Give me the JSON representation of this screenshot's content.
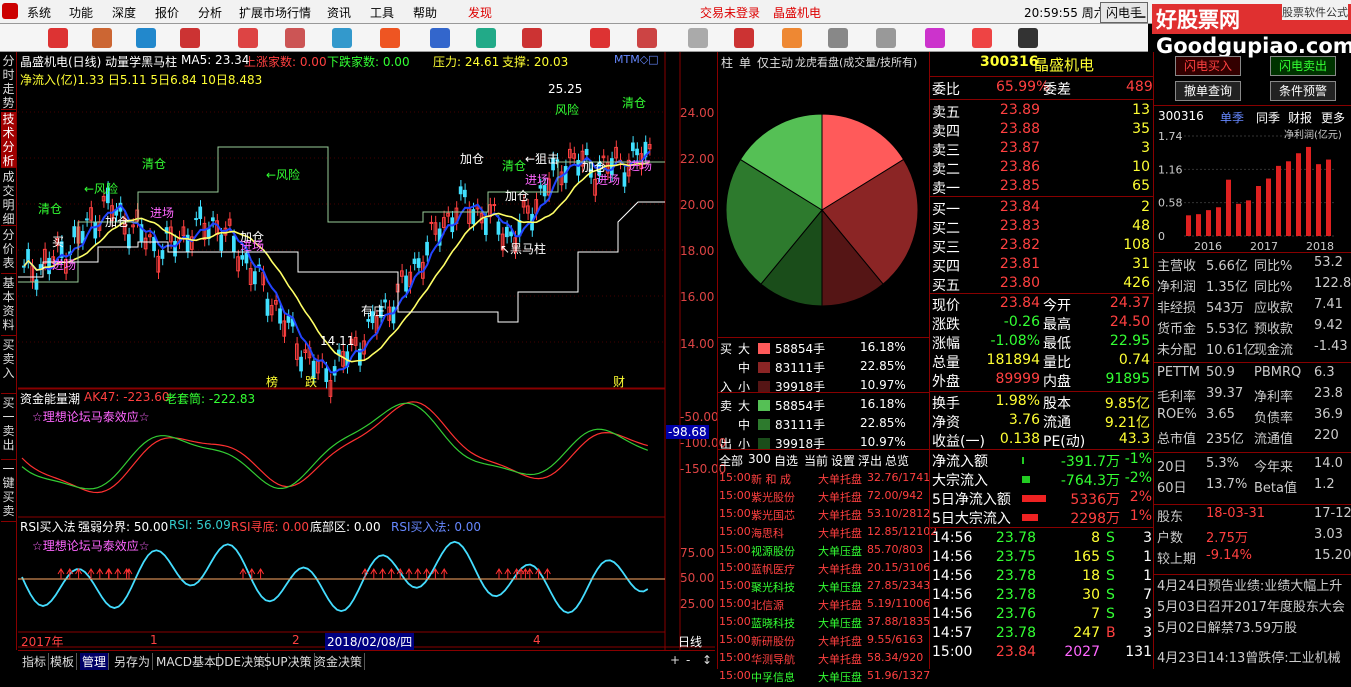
{
  "menu": {
    "items": [
      "系统",
      "功能",
      "深度",
      "报价",
      "分析",
      "扩展市场行情",
      "资讯",
      "工具",
      "帮助"
    ],
    "discover": "发现",
    "login": "交易未登录",
    "stock_name": "晶盛机电",
    "clock": "20:59:55 周六",
    "flash": "闪电手"
  },
  "brand": {
    "logo": "好股票网Goodgupiao.com",
    "sub": "股票软件公式"
  },
  "left_tabs": [
    "分时走势",
    "技术分析",
    "成交明细",
    "分价表",
    "基本资料",
    "买卖入",
    "买一卖出",
    "一键买卖"
  ],
  "chart": {
    "title": "晶盛机电(日线) 动量学黑马柱",
    "ma5": "MA5: 23.34",
    "up_count": "上涨家数: 0.00",
    "down_count": "下跌家数: 0.00",
    "pressure": "压力: 24.61",
    "support": "支撑: 20.03",
    "mtm": "MTM◇□",
    "net_flow": "净流入(亿)1.33 日5.11 5日6.84 10日8.483",
    "labels": {
      "high": "25.25",
      "low": "14.11",
      "risk1": "风险",
      "risk2": "←风险",
      "risk3": "←风险",
      "clear1": "清仓",
      "clear2": "清仓",
      "clear3": "清仓",
      "clear4": "清仓",
      "add1": "加仓",
      "add2": "加仓",
      "add3": "加仓",
      "add4": "加仓",
      "add5": "加仓",
      "enter1": "进场",
      "enter2": "进场",
      "enter3": "进场",
      "enter4": "进场",
      "enter5": "进场",
      "buy": "买",
      "hold": "有庄",
      "blackhorse": "↖黑马柱",
      "block": "←狙击",
      "bang": "榜",
      "die": "跌",
      "cai": "财"
    },
    "y_ticks": [
      "24.00",
      "22.00",
      "20.00",
      "18.00",
      "16.00",
      "14.00"
    ]
  },
  "panel2": {
    "title": "资金能量潮",
    "ak47": "AK47: -223.60",
    "lao": "老套筒: -222.83",
    "tag": "☆理想论坛马泰效应☆",
    "y_ticks": [
      "-50.00",
      "-100.00",
      "-150.00"
    ],
    "cur": "-98.68"
  },
  "panel3": {
    "title": "RSI买入法",
    "strong": "强弱分界: 50.00",
    "rsi": "RSI: 56.09",
    "rsi_low": "RSI寻底: 0.00",
    "bottom": "底部区: 0.00",
    "rsi_buy": "RSI买入法: 0.00",
    "tag": "☆理想论坛马泰效应☆",
    "y_ticks": [
      "75.00",
      "50.00",
      "25.00"
    ]
  },
  "x_axis": {
    "labels": [
      "2017年",
      "1",
      "2",
      "2018/02/08/四",
      "4"
    ],
    "period": "日线"
  },
  "bottom_tabs": [
    "指标",
    "模板",
    "管理",
    "另存为",
    "MACD基本",
    "DDE决策",
    "SUP决策",
    "资金决策"
  ],
  "mid": {
    "tabs": [
      "柱",
      "单",
      "仅主动",
      "龙虎看盘(成交量/技所有)"
    ],
    "pie": {
      "slices": [
        {
          "label": "大买",
          "value": 16.18,
          "color": "#ff5a5a"
        },
        {
          "label": "中买",
          "value": 22.85,
          "color": "#8b2525"
        },
        {
          "label": "小买",
          "value": 10.97,
          "color": "#551515"
        },
        {
          "label": "小卖",
          "value": 10.97,
          "color": "#1a4d1a"
        },
        {
          "label": "中卖",
          "value": 22.85,
          "color": "#2d7a2d"
        },
        {
          "label": "大卖",
          "value": 16.18,
          "color": "#55c055"
        }
      ]
    },
    "buy": [
      {
        "lvl": "大",
        "vol": "58854手",
        "pct": "16.18%",
        "color": "#ff5a5a"
      },
      {
        "lvl": "中",
        "vol": "83111手",
        "pct": "22.85%",
        "color": "#8b2525"
      },
      {
        "lvl": "小",
        "vol": "39918手",
        "pct": "10.97%",
        "color": "#551515"
      }
    ],
    "sell": [
      {
        "lvl": "大",
        "vol": "58854手",
        "pct": "16.18%",
        "color": "#55c055"
      },
      {
        "lvl": "中",
        "vol": "83111手",
        "pct": "22.85%",
        "color": "#2d7a2d"
      },
      {
        "lvl": "小",
        "vol": "39918手",
        "pct": "10.97%",
        "color": "#1a4d1a"
      }
    ],
    "side_buy": [
      "买",
      "入"
    ],
    "side_sell": [
      "卖",
      "出"
    ],
    "filter": [
      "全部",
      "300",
      "自选",
      "当前",
      "设置",
      "浮出",
      "总览"
    ],
    "news": [
      {
        "t": "15:00",
        "n": "新 和 成",
        "k": "大单托盘",
        "v": "32.76/1741"
      },
      {
        "t": "15:00",
        "n": "紫光股份",
        "k": "大单托盘",
        "v": "72.00/942"
      },
      {
        "t": "15:00",
        "n": "紫光国芯",
        "k": "大单托盘",
        "v": "53.10/2812"
      },
      {
        "t": "15:00",
        "n": "海思科",
        "k": "大单托盘",
        "v": "12.85/12102"
      },
      {
        "t": "15:00",
        "n": "视源股份",
        "k": "大单压盘",
        "v": "85.70/803"
      },
      {
        "t": "15:00",
        "n": "蓝帆医疗",
        "k": "大单托盘",
        "v": "20.15/3106"
      },
      {
        "t": "15:00",
        "n": "聚光科技",
        "k": "大单压盘",
        "v": "27.85/2343"
      },
      {
        "t": "15:00",
        "n": "北信源",
        "k": "大单托盘",
        "v": "5.19/11006"
      },
      {
        "t": "15:00",
        "n": "蓝晓科技",
        "k": "大单压盘",
        "v": "37.88/1835"
      },
      {
        "t": "15:00",
        "n": "新研股份",
        "k": "大单托盘",
        "v": "9.55/6163"
      },
      {
        "t": "15:00",
        "n": "华测导航",
        "k": "大单托盘",
        "v": "58.34/920"
      },
      {
        "t": "15:00",
        "n": "中孚信息",
        "k": "大单压盘",
        "v": "51.96/1327"
      }
    ]
  },
  "quote": {
    "code": "300316",
    "name": "晶盛机电",
    "wb_label": "委比",
    "wb": "65.99%",
    "wc_label": "委差",
    "wc": "489",
    "asks": [
      {
        "l": "卖五",
        "p": "23.89",
        "v": "13"
      },
      {
        "l": "卖四",
        "p": "23.88",
        "v": "35"
      },
      {
        "l": "卖三",
        "p": "23.87",
        "v": "3"
      },
      {
        "l": "卖二",
        "p": "23.86",
        "v": "10"
      },
      {
        "l": "卖一",
        "p": "23.85",
        "v": "65"
      }
    ],
    "bids": [
      {
        "l": "买一",
        "p": "23.84",
        "v": "2"
      },
      {
        "l": "买二",
        "p": "23.83",
        "v": "48"
      },
      {
        "l": "买三",
        "p": "23.82",
        "v": "108"
      },
      {
        "l": "买四",
        "p": "23.81",
        "v": "31"
      },
      {
        "l": "买五",
        "p": "23.80",
        "v": "426"
      }
    ],
    "stats": [
      {
        "a": "现价",
        "b": "23.84",
        "c": "今开",
        "d": "24.37"
      },
      {
        "a": "涨跌",
        "b": "-0.26",
        "c": "最高",
        "d": "24.50"
      },
      {
        "a": "涨幅",
        "b": "-1.08%",
        "c": "最低",
        "d": "22.95"
      },
      {
        "a": "总量",
        "b": "181894",
        "c": "量比",
        "d": "0.74"
      },
      {
        "a": "外盘",
        "b": "89999",
        "c": "内盘",
        "d": "91895"
      }
    ],
    "stats2": [
      {
        "a": "换手",
        "b": "1.98%",
        "c": "股本",
        "d": "9.85亿"
      },
      {
        "a": "净资",
        "b": "3.76",
        "c": "流通",
        "d": "9.21亿"
      },
      {
        "a": "收益(一)",
        "b": "0.138",
        "c": "PE(动)",
        "d": "43.3"
      }
    ],
    "flows": [
      {
        "a": "净流入额",
        "b": "-391.7万",
        "c": "-1%"
      },
      {
        "a": "大宗流入",
        "b": "-764.3万",
        "c": "-2%"
      },
      {
        "a": "5日净流入额",
        "b": "5336万",
        "c": "2%"
      },
      {
        "a": "5日大宗流入",
        "b": "2298万",
        "c": "1%"
      }
    ],
    "ticks": [
      {
        "t": "14:56",
        "p": "23.78",
        "v": "8",
        "s": "S",
        "n": "3"
      },
      {
        "t": "14:56",
        "p": "23.75",
        "v": "165",
        "s": "S",
        "n": "1"
      },
      {
        "t": "14:56",
        "p": "23.78",
        "v": "18",
        "s": "S",
        "n": "1"
      },
      {
        "t": "14:56",
        "p": "23.78",
        "v": "30",
        "s": "S",
        "n": "7"
      },
      {
        "t": "14:56",
        "p": "23.76",
        "v": "7",
        "s": "S",
        "n": "3"
      },
      {
        "t": "14:57",
        "p": "23.78",
        "v": "247",
        "s": "B",
        "n": "3"
      },
      {
        "t": "15:00",
        "p": "23.84",
        "v": "2027",
        "s": "",
        "n": "131"
      }
    ]
  },
  "right": {
    "btn_buy": "闪电买入",
    "btn_sell": "闪电卖出",
    "btn_cancel": "撤单查询",
    "btn_alert": "条件预警",
    "code": "300316",
    "tabs": [
      "单季",
      "同季",
      "财报",
      "更多"
    ],
    "chart_label": "净利润(亿元)",
    "bar_y": [
      "1.74",
      "1.16",
      "0.58",
      "0"
    ],
    "bar_x": [
      "2016",
      "2017",
      "2018"
    ],
    "bars": [
      0.36,
      0.38,
      0.45,
      0.5,
      0.98,
      0.56,
      0.62,
      0.87,
      1.0,
      1.22,
      1.3,
      1.44,
      1.55,
      1.25,
      1.33
    ],
    "fin": [
      {
        "a": "主营收",
        "b": "5.66亿",
        "c": "同比%",
        "d": "53.2"
      },
      {
        "a": "净利润",
        "b": "1.35亿",
        "c": "同比%",
        "d": "122.8"
      },
      {
        "a": "非经损",
        "b": "543万",
        "c": "应收款",
        "d": "7.41"
      },
      {
        "a": "货币金",
        "b": "5.53亿",
        "c": "预收款",
        "d": "9.42"
      },
      {
        "a": "未分配",
        "b": "10.61亿",
        "c": "现金流",
        "d": "-1.43"
      }
    ],
    "fin2": [
      {
        "a": "PETTM",
        "b": "50.9",
        "c": "PBMRQ",
        "d": "6.3"
      },
      {
        "a": "毛利率",
        "b": "39.37",
        "c": "净利率",
        "d": "23.8"
      },
      {
        "a": "ROE%",
        "b": "3.65",
        "c": "负债率",
        "d": "36.9"
      },
      {
        "a": "总市值",
        "b": "235亿",
        "c": "流通值",
        "d": "220"
      }
    ],
    "fin3": [
      {
        "a": "20日",
        "b": "5.3%",
        "c": "今年来",
        "d": "14.0"
      },
      {
        "a": "60日",
        "b": "13.7%",
        "c": "Beta值",
        "d": "1.2"
      }
    ],
    "fin4": [
      {
        "a": "股东",
        "b": "18-03-31",
        "d": "17-12-3"
      },
      {
        "a": "户数",
        "b": "2.75万",
        "d": "3.03"
      },
      {
        "a": "较上期",
        "b": "-9.14%",
        "d": "15.20"
      }
    ],
    "events": [
      "4月24日预告业绩:业绩大幅上升",
      "5月03日召开2017年度股东大会",
      "5月02日解禁73.59万股",
      "4月23日14:13曾跌停:工业机械"
    ]
  }
}
